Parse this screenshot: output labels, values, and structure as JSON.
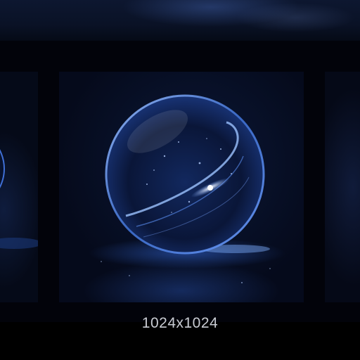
{
  "gallery": {
    "image_size_label": "1024x1024",
    "subject_icon": "glass-sphere-image",
    "colors": {
      "background": "#000000",
      "panel": "#050a1b",
      "sphere_glow": "#2d6bff",
      "caption_text": "#c9ccd3"
    }
  }
}
